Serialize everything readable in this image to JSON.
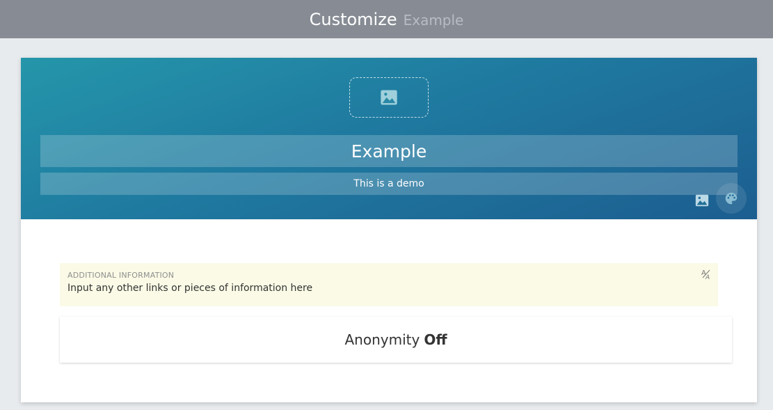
{
  "header": {
    "title": "Customize",
    "subtitle": "Example"
  },
  "hero": {
    "logo_placeholder_icon": "image-icon",
    "title": "Example",
    "subtitle": "This is a demo",
    "background_image_icon": "image-icon",
    "theme_icon": "palette-icon",
    "gradient_colors": [
      "#2596aa",
      "#1c5e90"
    ]
  },
  "additional_info": {
    "label": "ADDITIONAL INFORMATION",
    "value": "Input any other links or pieces of information here",
    "format_icon": "text-format-icon",
    "background": "#fafae6"
  },
  "anonymity": {
    "label": "Anonymity",
    "state": "Off"
  },
  "colors": {
    "topbar": "#878c94",
    "page_bg": "#e8ebee"
  }
}
